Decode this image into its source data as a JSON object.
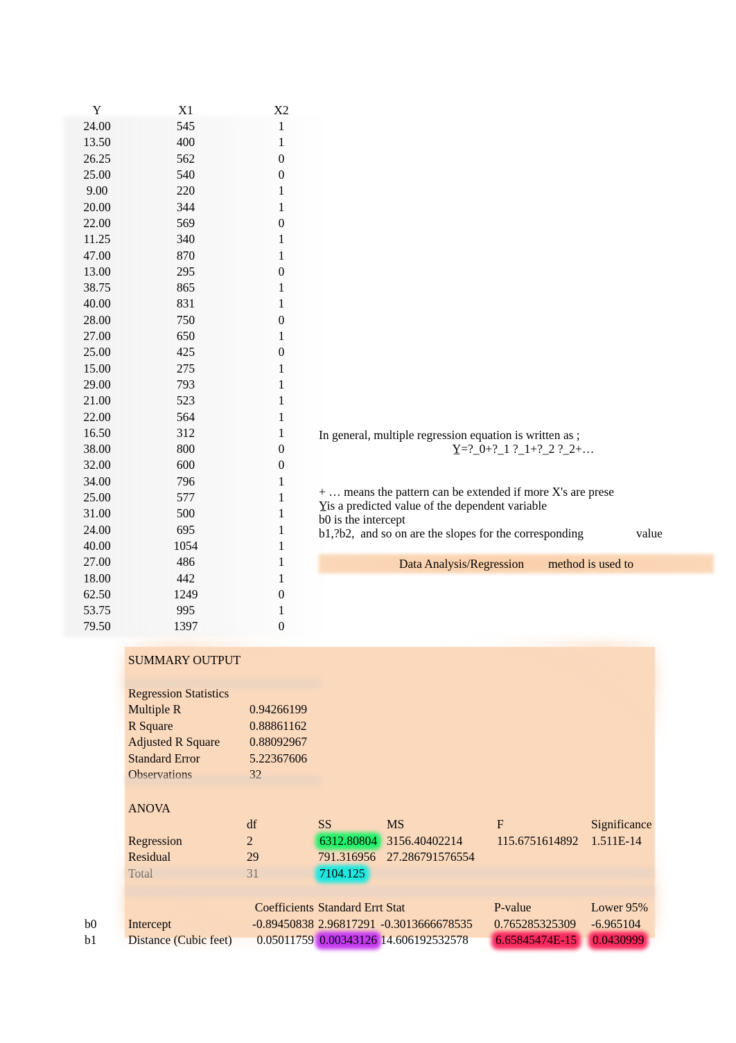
{
  "document": {
    "type": "spreadsheet-regression-worksheet"
  },
  "data_table": {
    "name": "regression-input-data",
    "headers": [
      "Y",
      "X1",
      "X2"
    ],
    "rows": [
      [
        "24.00",
        "545",
        "1"
      ],
      [
        "13.50",
        "400",
        "1"
      ],
      [
        "26.25",
        "562",
        "0"
      ],
      [
        "25.00",
        "540",
        "0"
      ],
      [
        "9.00",
        "220",
        "1"
      ],
      [
        "20.00",
        "344",
        "1"
      ],
      [
        "22.00",
        "569",
        "0"
      ],
      [
        "11.25",
        "340",
        "1"
      ],
      [
        "47.00",
        "870",
        "1"
      ],
      [
        "13.00",
        "295",
        "0"
      ],
      [
        "38.75",
        "865",
        "1"
      ],
      [
        "40.00",
        "831",
        "1"
      ],
      [
        "28.00",
        "750",
        "0"
      ],
      [
        "27.00",
        "650",
        "1"
      ],
      [
        "25.00",
        "425",
        "0"
      ],
      [
        "15.00",
        "275",
        "1"
      ],
      [
        "29.00",
        "793",
        "1"
      ],
      [
        "21.00",
        "523",
        "1"
      ],
      [
        "22.00",
        "564",
        "1"
      ],
      [
        "16.50",
        "312",
        "1"
      ],
      [
        "38.00",
        "800",
        "0"
      ],
      [
        "32.00",
        "600",
        "0"
      ],
      [
        "34.00",
        "796",
        "1"
      ],
      [
        "25.00",
        "577",
        "1"
      ],
      [
        "31.00",
        "500",
        "1"
      ],
      [
        "24.00",
        "695",
        "1"
      ],
      [
        "40.00",
        "1054",
        "1"
      ],
      [
        "27.00",
        "486",
        "1"
      ],
      [
        "18.00",
        "442",
        "1"
      ],
      [
        "62.50",
        "1249",
        "0"
      ],
      [
        "53.75",
        "995",
        "1"
      ],
      [
        "79.50",
        "1397",
        "0"
      ]
    ]
  },
  "notes": {
    "intro": "In general, multiple regression equation is written as ;",
    "equation": "Y̲=?_0+?_1 ?_1+?_2 ?_2+…",
    "bullets": [
      "+ … means the pattern can be extended if more X's are prese",
      "Y̲is a predicted value of the dependent variable",
      "b0 is the intercept"
    ],
    "slope_line": "b1,?b2,  and so on are the slopes for the corresponding",
    "slope_tail": "value",
    "method_text": "Data Analysis/Regression        method is used to"
  },
  "summary": {
    "title": "SUMMARY OUTPUT",
    "regression_statistics": {
      "heading": "Regression Statistics",
      "rows": [
        {
          "label": "Multiple R",
          "value": "0.94266199"
        },
        {
          "label": "R Square",
          "value": "0.88861162"
        },
        {
          "label": "Adjusted R Square",
          "value": "0.88092967"
        },
        {
          "label": "Standard Error",
          "value": "5.22367606"
        },
        {
          "label": "Observations",
          "value": "32"
        }
      ]
    },
    "anova": {
      "heading": "ANOVA",
      "headers": {
        "df": "df",
        "ss": "SS",
        "ms": "MS",
        "f": "F",
        "significance": "Significance"
      },
      "rows": [
        {
          "name": "Regression",
          "df": "2",
          "ss": "6312.80804",
          "ms": "3156.40402214",
          "f": "115.6751614892",
          "significance": "1.511E-14"
        },
        {
          "name": "Residual",
          "df": "29",
          "ss": "791.316956",
          "ms": "27.286791576554",
          "f": "",
          "significance": ""
        },
        {
          "name": "Total",
          "df": "31",
          "ss": "7104.125",
          "ms": "",
          "f": "",
          "significance": ""
        }
      ]
    },
    "coefficients": {
      "headers": {
        "coefficients": "Coefficients",
        "standard_error_tstat": "Standard Errt Stat",
        "p_value": "P-value",
        "lower95": "Lower 95%"
      },
      "rows": [
        {
          "b": "b0",
          "name": "Intercept",
          "coefficient": "-0.89450838",
          "standard_error": "2.96817291",
          "t_stat": "-0.3013666678535",
          "p_value": "0.765285325309",
          "lower95": "-6.965104"
        },
        {
          "b": "b1",
          "name": "Distance (Cubic feet)",
          "coefficient": "0.05011759",
          "standard_error": "0.00343126",
          "t_stat": "14.606192532578",
          "p_value": "6.65845474E-15",
          "lower95": "0.0430999"
        }
      ]
    }
  },
  "colors": {
    "panel_peach": "#fad9bd",
    "highlight_green": "#22f06a",
    "highlight_cyan": "#1ee8e0",
    "highlight_purple": "#c63af0",
    "highlight_red": "#f8295f",
    "text": "#000000",
    "page_background": "#ffffff"
  }
}
